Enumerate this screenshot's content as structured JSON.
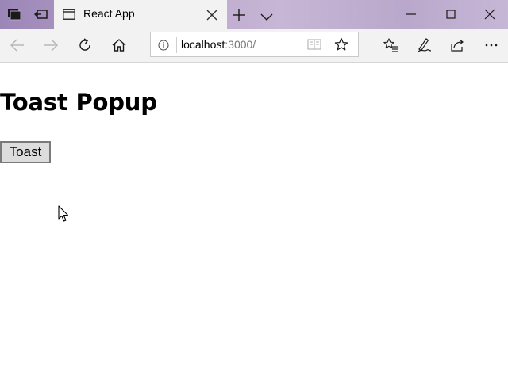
{
  "browser": {
    "tab": {
      "title": "React App"
    },
    "address_bar": {
      "host": "localhost",
      "path": ":3000/"
    },
    "icons": {
      "tabs_aside": "tabs-aside-icon",
      "restore_tabs": "restore-tabs-icon",
      "favicon": "page-icon",
      "close": "close-icon",
      "new_tab": "plus-icon",
      "tab_preview": "chevron-down-icon",
      "minimize": "minimize-icon",
      "maximize": "maximize-icon",
      "window_close": "close-icon",
      "back": "back-arrow-icon",
      "forward": "forward-arrow-icon",
      "refresh": "refresh-icon",
      "home": "home-icon",
      "info": "info-icon",
      "reading_view": "book-icon",
      "favorite": "star-icon",
      "favorites_hub": "favorites-list-icon",
      "notes": "pen-icon",
      "share": "share-icon",
      "more": "ellipsis-icon"
    },
    "colors": {
      "titlebar_accent": "#b7a3c8",
      "chrome": "#f2f2f2"
    }
  },
  "page": {
    "heading": "Toast Popup",
    "toast_button_label": "Toast"
  }
}
